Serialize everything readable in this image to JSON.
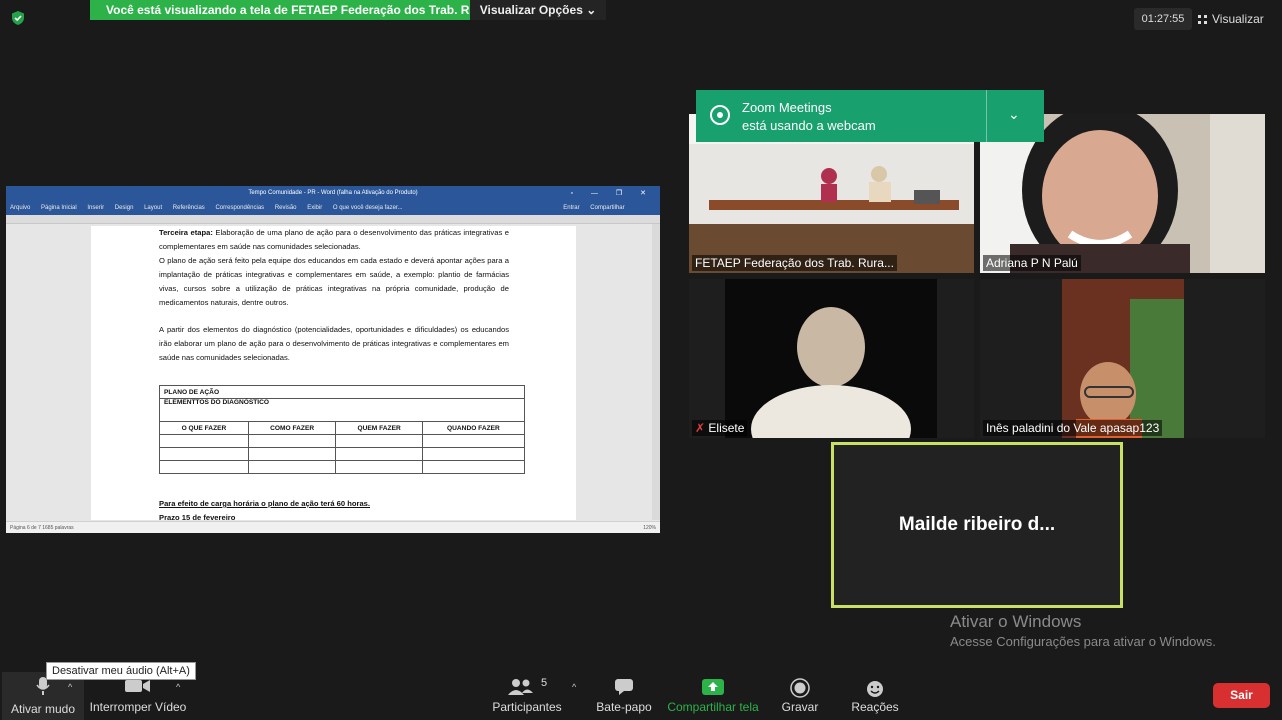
{
  "top": {
    "share_banner": "Você está visualizando a tela de FETAEP Federação dos Trab. Rur...",
    "view_options": "Visualizar Opções",
    "timer": "01:27:55",
    "view": "Visualizar"
  },
  "doc": {
    "title": "Tempo Comunidade - PR - Word (falha na Ativação do Produto)",
    "menu": [
      "Arquivo",
      "Página Inicial",
      "Inserir",
      "Design",
      "Layout",
      "Referências",
      "Correspondências",
      "Revisão",
      "Exibir",
      "O que você deseja fazer...",
      "Entrar",
      "Compartilhar"
    ],
    "p1_bold": "Terceira etapa:",
    "p1": "Elaboração de uma plano de ação para o desenvolvimento das práticas integrativas e complementares em saúde nas comunidades selecionadas.",
    "p2": "O plano de ação será feito pela equipe dos educandos em cada estado e deverá apontar ações para a implantação de práticas integrativas e complementares em saúde, a exemplo: plantio de farmácias vivas, cursos sobre a utilização de práticas integrativas na própria comunidade, produção de medicamentos naturais, dentre outros.",
    "p3": "A partir dos elementos do diagnóstico (potencialidades, oportunidades e dificuldades) os educandos irão elaborar um plano de ação para o desenvolvimento de práticas integrativas e complementares em saúde nas comunidades selecionadas.",
    "table_title": "PLANO DE AÇÃO",
    "table_sub": "ELEMENTTOS DO DIAGNÓSTICO",
    "cols": [
      "O QUE FAZER",
      "COMO FAZER",
      "QUEM FAZER",
      "QUANDO FAZER"
    ],
    "note1": "Para efeito de carga horária o plano de ação terá 60 horas.",
    "note2": "Prazo 15 de fevereiro",
    "status": "Página 6 de 7    1685 palavras",
    "zoom": "120%"
  },
  "notification": {
    "title": "Zoom Meetings",
    "body": "está usando a webcam"
  },
  "participants": [
    {
      "name": "FETAEP Federação dos Trab. Rura..."
    },
    {
      "name": "Adriana P N Palú"
    },
    {
      "name": "Elisete"
    },
    {
      "name": "Inês paladini do Vale apasap123"
    },
    {
      "name": "Mailde ribeiro d..."
    }
  ],
  "watermark": {
    "title": "Ativar o Windows",
    "sub": "Acesse Configurações para ativar o Windows."
  },
  "toolbar": {
    "tooltip": "Desativar meu áudio (Alt+A)",
    "mute": "Ativar mudo",
    "video": "Interromper Vídeo",
    "participants": "Participantes",
    "participants_count": "5",
    "chat": "Bate-papo",
    "share": "Compartilhar tela",
    "record": "Gravar",
    "reactions": "Reações",
    "leave": "Sair"
  },
  "colors": {
    "share_green": "#2db24a",
    "notif_green": "#18a06e",
    "speaker_border": "#c8e064",
    "leave_red": "#d83030",
    "word_blue": "#2b579a"
  }
}
